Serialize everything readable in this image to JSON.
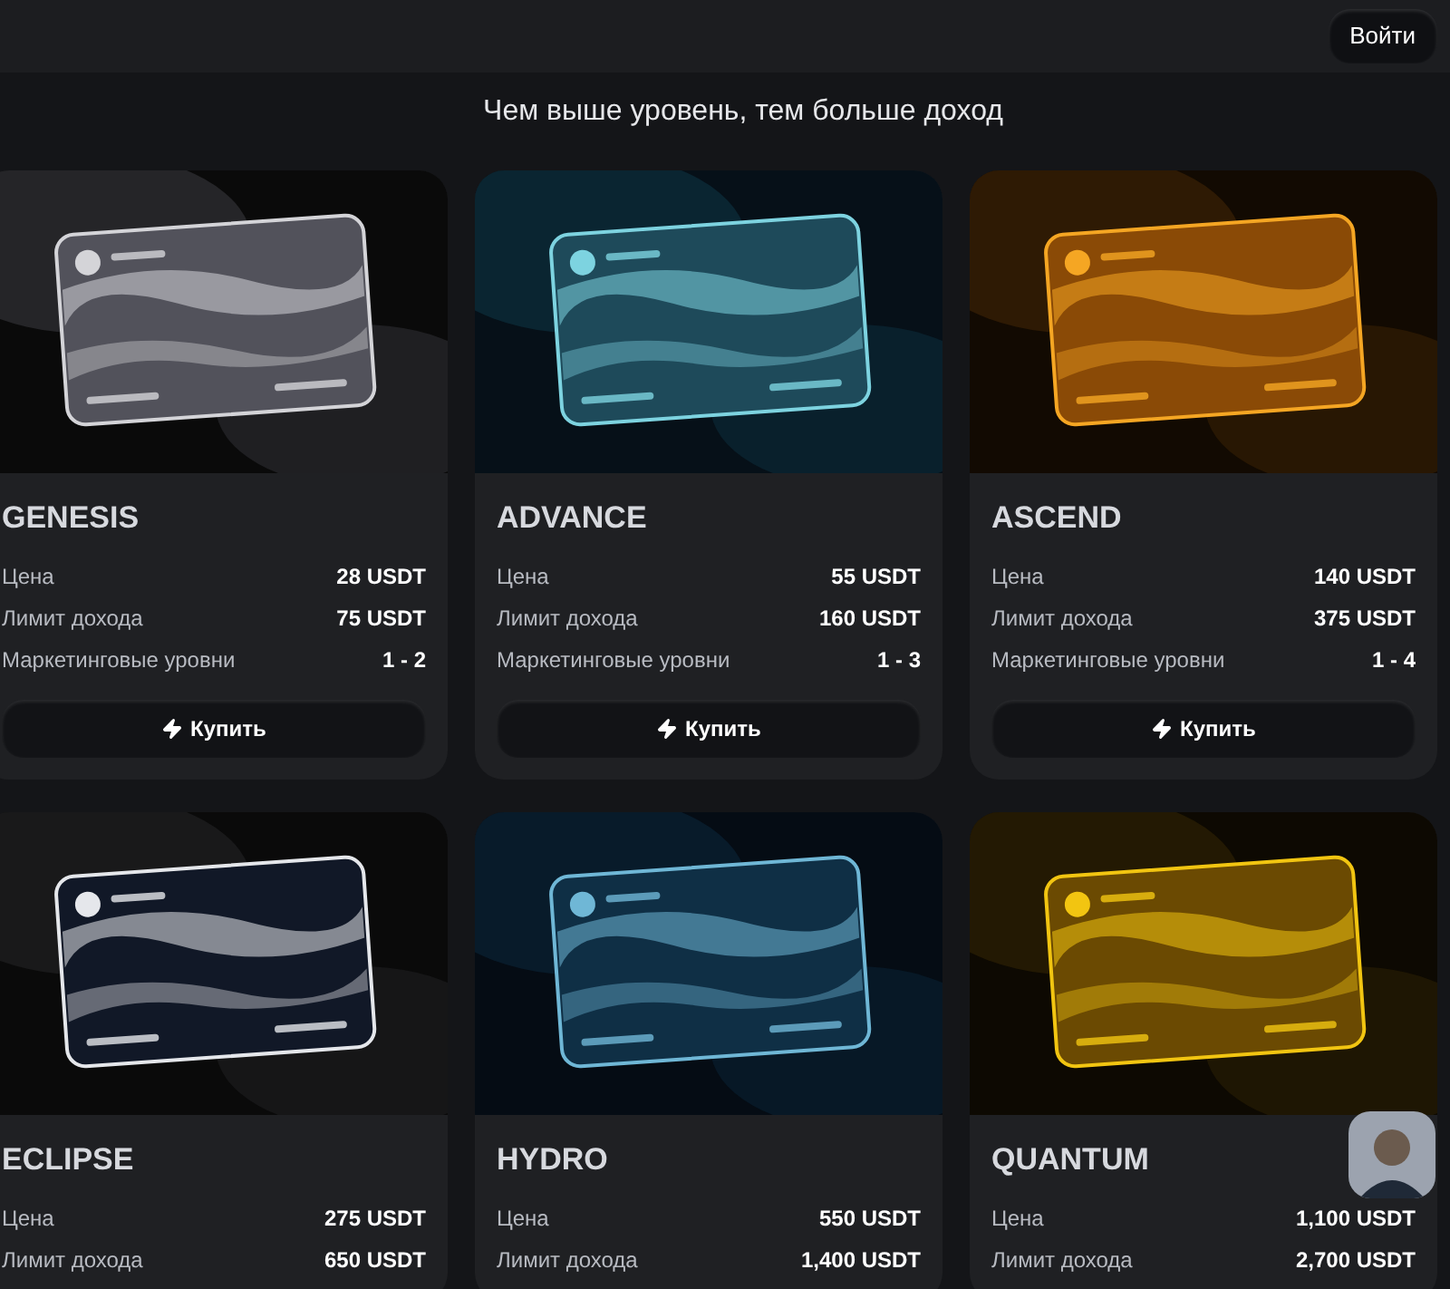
{
  "header": {
    "login_button": "Войти"
  },
  "heading": "Чем выше уровень, тем больше доход",
  "plans": [
    {
      "name": "GENESIS",
      "rows": [
        {
          "label": "Цена",
          "value": "28 USDT"
        },
        {
          "label": "Лимит дохода",
          "value": "75 USDT"
        },
        {
          "label": "Маркетинговые уровни",
          "value": "1 - 2"
        }
      ],
      "buy_button": "Купить"
    },
    {
      "name": "ADVANCE",
      "rows": [
        {
          "label": "Цена",
          "value": "55 USDT"
        },
        {
          "label": "Лимит дохода",
          "value": "160 USDT"
        },
        {
          "label": "Маркетинговые уровни",
          "value": "1 - 3"
        }
      ],
      "buy_button": "Купить"
    },
    {
      "name": "ASCEND",
      "rows": [
        {
          "label": "Цена",
          "value": "140 USDT"
        },
        {
          "label": "Лимит дохода",
          "value": "375 USDT"
        },
        {
          "label": "Маркетинговые уровни",
          "value": "1 - 4"
        }
      ],
      "buy_button": "Купить"
    },
    {
      "name": "ECLIPSE",
      "rows": [
        {
          "label": "Цена",
          "value": "275 USDT"
        },
        {
          "label": "Лимит дохода",
          "value": "650 USDT"
        }
      ]
    },
    {
      "name": "HYDRO",
      "rows": [
        {
          "label": "Цена",
          "value": "550 USDT"
        },
        {
          "label": "Лимит дохода",
          "value": "1,400 USDT"
        }
      ]
    },
    {
      "name": "QUANTUM",
      "rows": [
        {
          "label": "Цена",
          "value": "1,100 USDT"
        },
        {
          "label": "Лимит дохода",
          "value": "2,700 USDT"
        }
      ]
    }
  ]
}
